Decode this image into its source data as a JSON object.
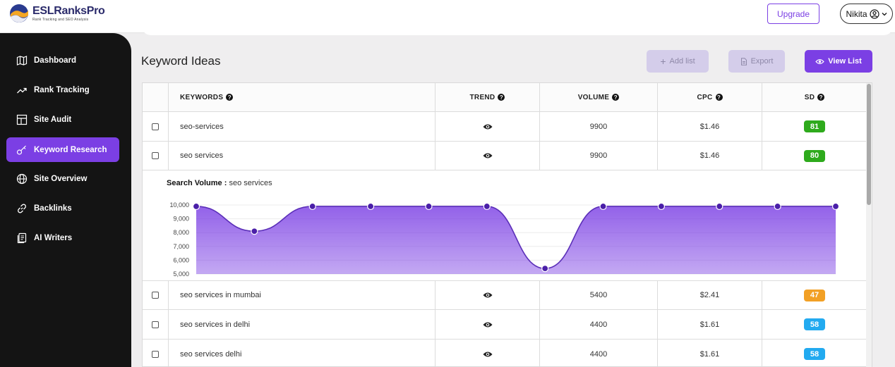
{
  "header": {
    "brand_name": "ESLRanksPro",
    "brand_tagline": "Rank Tracking and SEO Analysis",
    "upgrade_label": "Upgrade",
    "user_name": "Nikita"
  },
  "sidebar": {
    "items": [
      {
        "label": "Dashboard",
        "icon": "map-icon"
      },
      {
        "label": "Rank Tracking",
        "icon": "trend-line-icon"
      },
      {
        "label": "Site Audit",
        "icon": "layout-icon"
      },
      {
        "label": "Keyword Research",
        "icon": "key-icon",
        "active": true
      },
      {
        "label": "Site Overview",
        "icon": "globe-icon"
      },
      {
        "label": "Backlinks",
        "icon": "link-icon"
      },
      {
        "label": "AI Writers",
        "icon": "document-icon"
      }
    ]
  },
  "main": {
    "title": "Keyword Ideas",
    "add_list_label": "Add list",
    "export_label": "Export",
    "view_list_label": "View List"
  },
  "table": {
    "headers": [
      "KEYWORDS",
      "TREND",
      "VOLUME",
      "CPC",
      "SD"
    ],
    "rows": [
      {
        "keyword": "seo-services",
        "volume": "9900",
        "cpc": "$1.46",
        "sd": "81",
        "sd_color": "#2eaa1c"
      },
      {
        "keyword": "seo services",
        "volume": "9900",
        "cpc": "$1.46",
        "sd": "80",
        "sd_color": "#2eaa1c"
      },
      {
        "keyword": "seo services in mumbai",
        "volume": "5400",
        "cpc": "$2.41",
        "sd": "47",
        "sd_color": "#f2a025"
      },
      {
        "keyword": "seo services in delhi",
        "volume": "4400",
        "cpc": "$1.61",
        "sd": "58",
        "sd_color": "#22aaf0"
      },
      {
        "keyword": "seo services delhi",
        "volume": "4400",
        "cpc": "$1.61",
        "sd": "58",
        "sd_color": "#22aaf0"
      }
    ]
  },
  "trend_panel": {
    "label": "Search Volume :",
    "keyword": "seo services"
  },
  "chart_data": {
    "type": "area",
    "title": "",
    "xlabel": "",
    "ylabel": "",
    "ylim": [
      5000,
      10000
    ],
    "y_ticks": [
      "10,000",
      "9,000",
      "8,000",
      "7,000",
      "6,000",
      "5,000"
    ],
    "series": [
      {
        "values": [
          9900,
          8100,
          9900,
          9900,
          9900,
          9900,
          5400,
          9900,
          9900,
          9900,
          9900,
          9900
        ]
      }
    ],
    "color": "#7b3fe4",
    "grid": true
  }
}
